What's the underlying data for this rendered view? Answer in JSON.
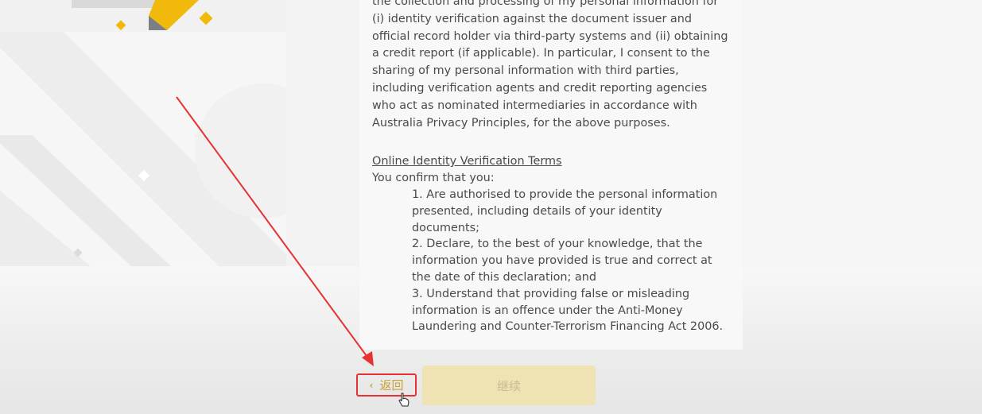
{
  "document": {
    "consent_paragraph": "the collection and processing of my personal information for (i) identity verification against the document issuer and official record holder via third-party systems and (ii) obtaining a credit report (if applicable). In particular, I consent to the sharing of my personal information with third parties, including verification agents and credit reporting agencies who act as nominated intermediaries in accordance with Australia Privacy Principles, for the above purposes.",
    "terms_heading": "Online Identity Verification Terms",
    "confirm_line": "You confirm that you:",
    "terms": [
      "1. Are authorised to provide the personal information presented, including details of your identity documents;",
      "2. Declare, to the best of your knowledge, that the information you have provided is true and correct at the date of this declaration; and",
      "3. Understand that providing false or misleading information is an offence under the Anti-Money Laundering and Counter-Terrorism Financing Act 2006."
    ]
  },
  "actions": {
    "back_label": "返回",
    "continue_label": "继续"
  },
  "annotation": {
    "highlight_color": "#e53333"
  },
  "colors": {
    "brand_yellow": "#f0b90b",
    "button_disabled_bg": "#efe2b3"
  }
}
